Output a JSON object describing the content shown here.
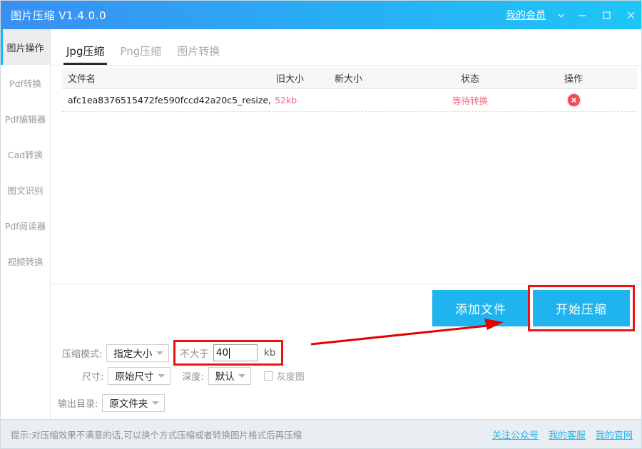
{
  "window": {
    "title": "图片压缩 V1.4.0.0",
    "member_link": "我的会员",
    "chevron_icon": "chevron-down-icon",
    "minimize_icon": "minimize-icon",
    "maximize_icon": "maximize-icon",
    "close_icon": "close-icon",
    "titlebar_gradient_from": "#3a8ff2",
    "titlebar_gradient_to": "#1ec6f6"
  },
  "sidebar": {
    "items": [
      {
        "label": "图片操作",
        "active": true
      },
      {
        "label": "Pdf转换",
        "active": false
      },
      {
        "label": "Pdf编辑器",
        "active": false
      },
      {
        "label": "Cad转换",
        "active": false
      },
      {
        "label": "图文识别",
        "active": false
      },
      {
        "label": "Pdf阅读器",
        "active": false
      },
      {
        "label": "视频转换",
        "active": false
      }
    ],
    "active_accent": "#19b5f3"
  },
  "tabs": [
    {
      "label": "Jpg压缩",
      "active": true
    },
    {
      "label": "Png压缩",
      "active": false
    },
    {
      "label": "图片转换",
      "active": false
    }
  ],
  "table": {
    "columns": {
      "filename": "文件名",
      "old_size": "旧大小",
      "new_size": "新大小",
      "status": "状态",
      "action": "操作"
    },
    "rows": [
      {
        "filename": "afc1ea8376515472fe590fccd42a20c5_resize,",
        "old_size": "52kb",
        "new_size": "",
        "status": "等待转换",
        "action_icon": "delete-circle-icon"
      }
    ],
    "status_color": "#f4687e"
  },
  "actions": {
    "add_file": "添加文件",
    "start_compress": "开始压缩",
    "button_color": "#1fb4ef",
    "highlight_color": "#ee1111"
  },
  "options": {
    "mode_label": "压缩模式:",
    "mode_value": "指定大小",
    "limit_prefix": "不大于",
    "limit_value": "40",
    "limit_unit": "kb",
    "size_label": "尺寸:",
    "size_value": "原始尺寸",
    "depth_label": "深度:",
    "depth_value": "默认",
    "gray_label": "灰度图",
    "gray_checked": false,
    "output_label": "输出目录:",
    "output_value": "原文件夹"
  },
  "footer": {
    "tip": "提示:对压缩效果不满意的话,可以换个方式压缩或者转换图片格式后再压缩",
    "links": [
      "关注公众号",
      "我的客服",
      "我的官网"
    ],
    "link_color": "#1fb4ef"
  }
}
